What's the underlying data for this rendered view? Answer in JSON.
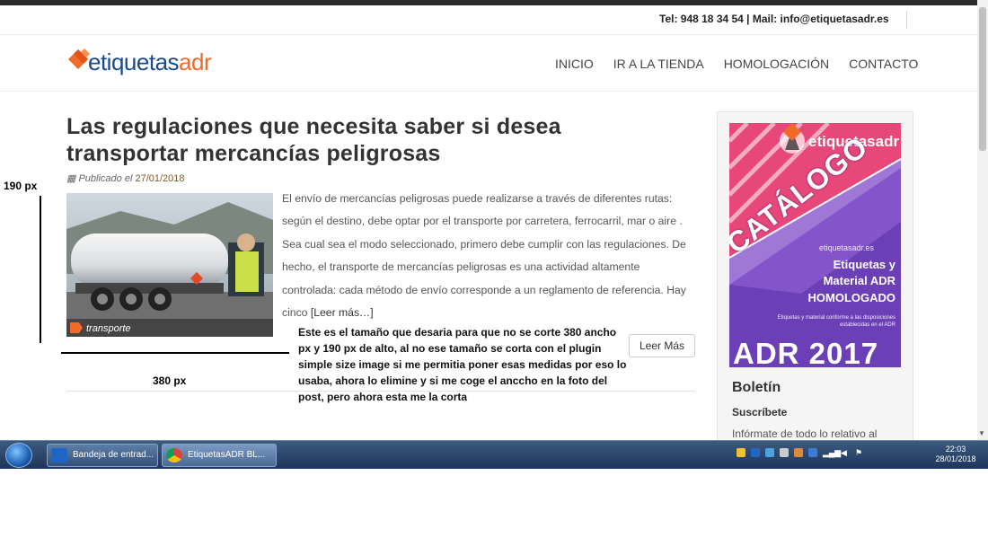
{
  "site": {
    "contact": "Tel: 948 18 34 54 | Mail: info@etiquetasadr.es",
    "logo_part1": "etiquetas",
    "logo_part2": "adr",
    "nav": [
      "INICIO",
      "IR A LA TIENDA",
      "HOMOLOGACIÓN",
      "CONTACTO"
    ]
  },
  "post": {
    "title": "Las regulaciones que necesita saber si desea transportar mercancías peligrosas",
    "meta_prefix": "Publicado el",
    "date": "27/01/2018",
    "image_caption": "transporte",
    "excerpt": "El envío de mercancías peligrosas puede realizarse a través de diferentes rutas: según el destino, debe optar por el transporte por carretera, ferrocarril, mar o aire . Sea cual sea el modo seleccionado, primero debe cumplir con las regulaciones. De hecho, el transporte de mercancías peligrosas es una actividad altamente controlada: cada método de envío corresponde a un reglamento de referencia. Hay cinco",
    "read_more_link": "[Leer más…]",
    "read_more_button": "Leer Más"
  },
  "annotation": {
    "height_label": "190 px",
    "width_label": "380 px",
    "note": "Este es el tamaño que desaria para que no se corte 380 ancho px y 190 px de alto, al no ese tamaño se corta con el plugin simple size image si me permitia poner esas medidas por eso lo usaba, ahora lo elimine y si me coge el anccho en la foto del post, pero ahora esta me la corta"
  },
  "sidebar": {
    "catalog": {
      "brand": "etiquetasadr",
      "title": "CATÁLOGO",
      "site": "etiquetasadr.es",
      "line1": "Etiquetas y",
      "line2": "Material ADR",
      "line3": "HOMOLOGADO",
      "small": "Etiquetas y material conforme a las disposiciones establecidas en el ADR",
      "adr": "ADR 2017"
    },
    "heading": "Boletín",
    "subheading": "Suscríbete",
    "text": "Infórmate de todo lo relativo al"
  },
  "taskbar": {
    "items": [
      {
        "label": "Bandeja de entrad..."
      },
      {
        "label": "EtiquetasADR BL..."
      }
    ],
    "time": "22:03",
    "date": "28/01/2018"
  },
  "colors": {
    "brand_blue": "#1a4a8a",
    "brand_orange": "#f06a2a",
    "catalog_purple": "#6b3fb5",
    "catalog_pink": "#e8477a"
  }
}
